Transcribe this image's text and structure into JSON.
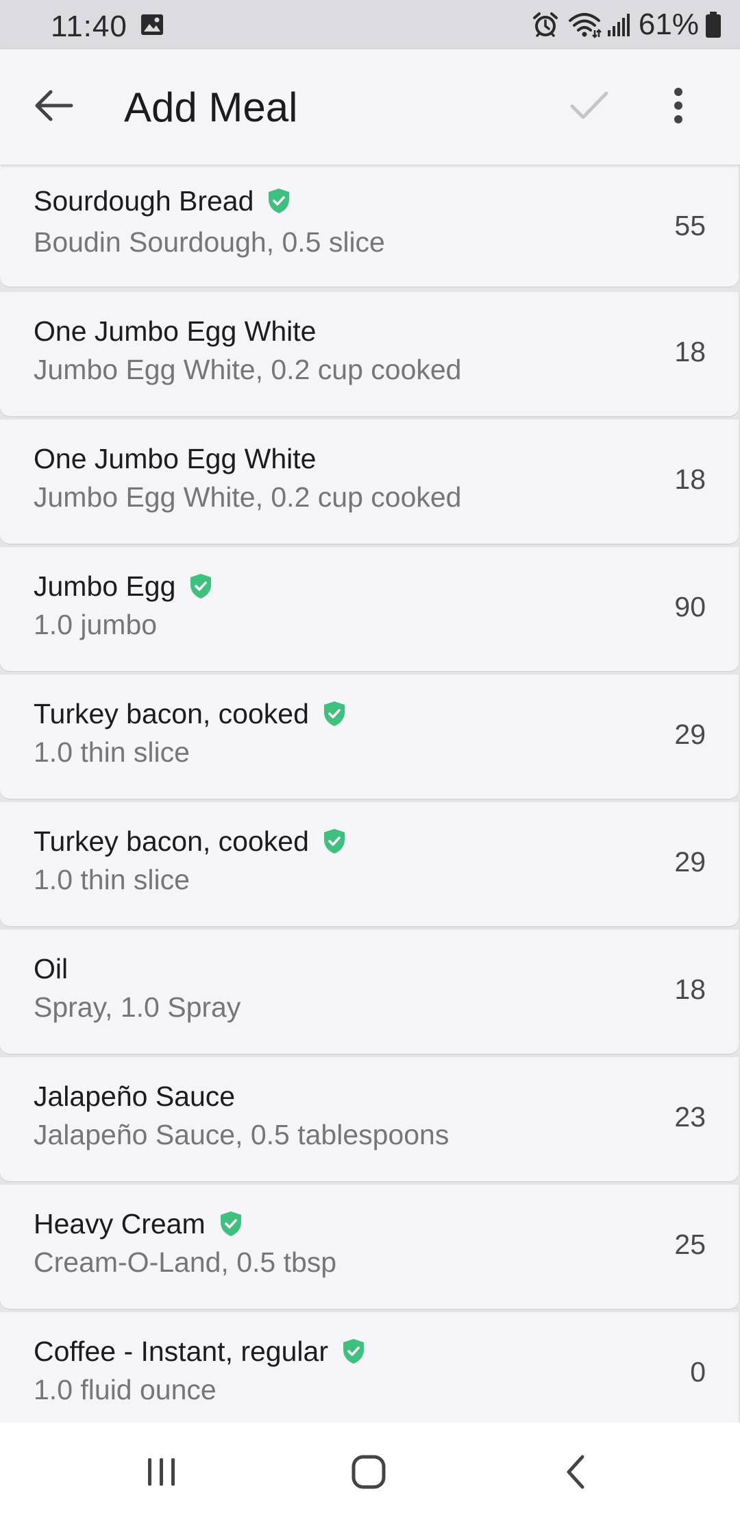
{
  "status_bar": {
    "time": "11:40",
    "battery": "61%"
  },
  "app_bar": {
    "title": "Add Meal",
    "back_icon": "arrow-left-icon",
    "confirm_icon": "checkmark-icon",
    "more_icon": "more-vert-icon"
  },
  "colors": {
    "verified_badge": "#3fc07f",
    "confirm_disabled": "#c5c5c9"
  },
  "meals": [
    {
      "name": "Sourdough Bread",
      "detail": "Boudin Sourdough, 0.5 slice",
      "calories": "55",
      "verified": true
    },
    {
      "name": "One Jumbo Egg White",
      "detail": "Jumbo Egg White, 0.2 cup cooked",
      "calories": "18",
      "verified": false
    },
    {
      "name": "One Jumbo Egg White",
      "detail": "Jumbo Egg White, 0.2 cup cooked",
      "calories": "18",
      "verified": false
    },
    {
      "name": "Jumbo Egg",
      "detail": "1.0 jumbo",
      "calories": "90",
      "verified": true
    },
    {
      "name": "Turkey bacon, cooked",
      "detail": "1.0 thin slice",
      "calories": "29",
      "verified": true
    },
    {
      "name": "Turkey bacon, cooked",
      "detail": "1.0 thin slice",
      "calories": "29",
      "verified": true
    },
    {
      "name": "Oil",
      "detail": "Spray, 1.0 Spray",
      "calories": "18",
      "verified": false
    },
    {
      "name": "Jalapeño Sauce",
      "detail": "Jalapeño Sauce, 0.5 tablespoons",
      "calories": "23",
      "verified": false
    },
    {
      "name": "Heavy Cream",
      "detail": "Cream-O-Land, 0.5 tbsp",
      "calories": "25",
      "verified": true
    },
    {
      "name": "Coffee - Instant, regular",
      "detail": "1.0 fluid ounce",
      "calories": "0",
      "verified": true
    }
  ],
  "nav_bar": {
    "recents_icon": "recents-icon",
    "home_icon": "home-icon",
    "back_icon": "nav-back-icon"
  }
}
